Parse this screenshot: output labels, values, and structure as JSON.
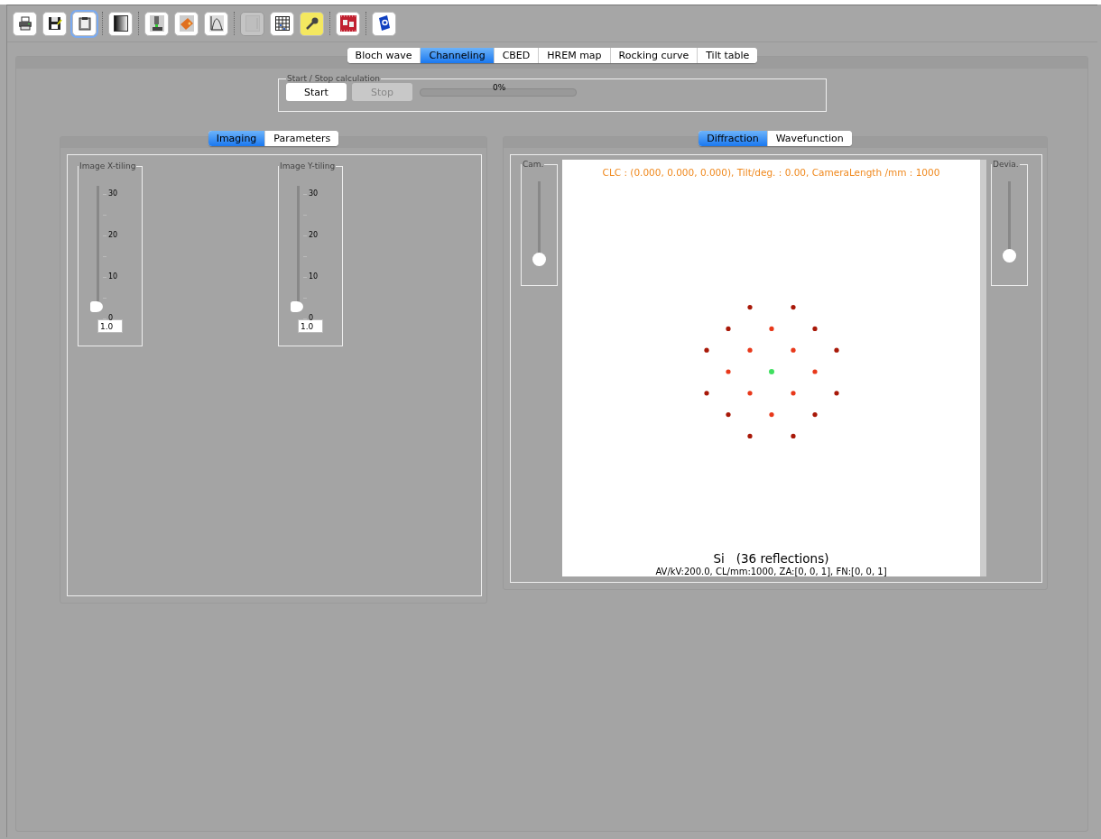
{
  "toolbar": [
    [
      {
        "kind": "printer",
        "on": false,
        "focused": false,
        "disabled": false
      },
      {
        "kind": "save",
        "on": false,
        "focused": false,
        "disabled": false
      },
      {
        "kind": "clipboard",
        "on": false,
        "focused": true,
        "disabled": false
      }
    ],
    [
      {
        "kind": "gradient",
        "on": false,
        "focused": false,
        "disabled": false
      }
    ],
    [
      {
        "kind": "microscope",
        "on": false,
        "focused": false,
        "disabled": false
      },
      {
        "kind": "tag",
        "on": false,
        "focused": false,
        "disabled": false
      },
      {
        "kind": "curve",
        "on": false,
        "focused": false,
        "disabled": false
      }
    ],
    [
      {
        "kind": "blank",
        "on": false,
        "focused": false,
        "disabled": true
      },
      {
        "kind": "grid",
        "on": false,
        "focused": false,
        "disabled": false
      },
      {
        "kind": "key",
        "on": true,
        "focused": false,
        "disabled": false
      }
    ],
    [
      {
        "kind": "film",
        "on": false,
        "focused": false,
        "disabled": false
      }
    ],
    [
      {
        "kind": "help",
        "on": false,
        "focused": false,
        "disabled": false
      }
    ]
  ],
  "tabs": [
    {
      "label": "Bloch wave",
      "selected": false
    },
    {
      "label": "Channeling",
      "selected": true
    },
    {
      "label": "CBED",
      "selected": false
    },
    {
      "label": "HREM map",
      "selected": false
    },
    {
      "label": "Rocking curve",
      "selected": false
    },
    {
      "label": "Tilt table",
      "selected": false
    }
  ],
  "calculation": {
    "title": "Start / Stop calculation",
    "start": {
      "label": "Start",
      "disabled": false
    },
    "stop": {
      "label": "Stop",
      "disabled": true
    },
    "progress": {
      "level": 0,
      "reading": "0%"
    }
  },
  "imaging_panel": {
    "tabs": [
      {
        "label": "Imaging",
        "selected": true
      },
      {
        "label": "Parameters",
        "selected": false
      }
    ],
    "sliders": [
      {
        "title": "Image X-tiling",
        "ticks": [
          "30",
          "20",
          "10",
          "0"
        ],
        "level": 0,
        "value": "1.0"
      },
      {
        "title": "Image Y-tiling",
        "ticks": [
          "30",
          "20",
          "10",
          "0"
        ],
        "level": 0,
        "value": "1.0"
      }
    ]
  },
  "diffraction_panel": {
    "tabs": [
      {
        "label": "Diffraction",
        "selected": true
      },
      {
        "label": "Wavefunction",
        "selected": false
      }
    ],
    "left_slider": {
      "title": "Cam.",
      "level": 0
    },
    "right_slider": {
      "title": "Devia.",
      "level": 0.05
    },
    "header": "CLC : (0.000, 0.000, 0.000), Tilt/deg. : 0.00, CameraLength /mm : 1000",
    "title": "Si   (36 reflections)",
    "info": "AV/kV:200.0, CL/mm:1000, ZA:[0, 0, 1], FN:[0, 0, 1]"
  }
}
